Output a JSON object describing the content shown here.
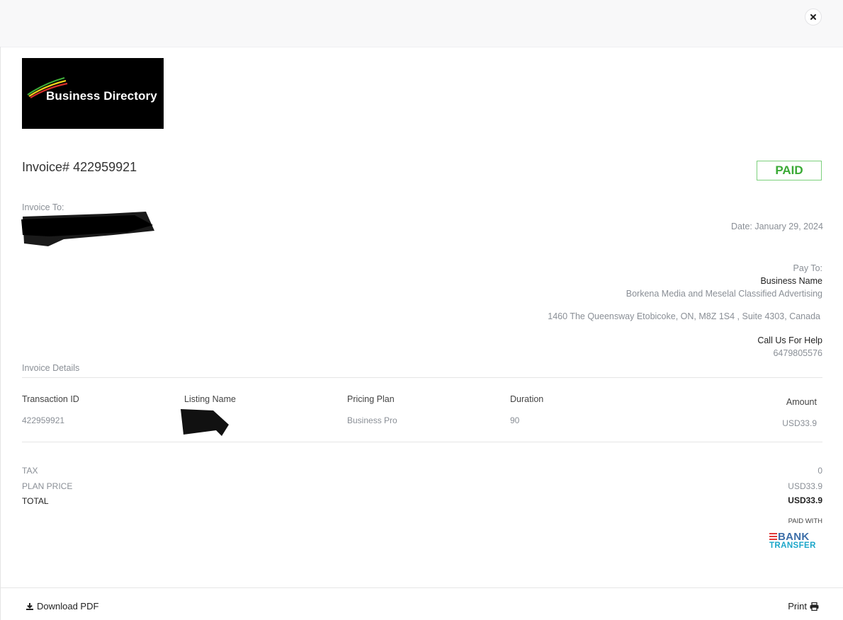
{
  "logo": {
    "text": "Business Directory"
  },
  "invoice": {
    "label": "Invoice#",
    "number": "422959921",
    "status": "PAID"
  },
  "invoice_to": {
    "label": "Invoice To:"
  },
  "date": {
    "text": "Date: January 29, 2024"
  },
  "pay_to": {
    "label": "Pay To:",
    "business_label": "Business Name",
    "business_name": "Borkena Media and Meselal Classified Advertising",
    "address": "1460 The Queensway Etobicoke, ON, M8Z 1S4 , Suite 4303, Canada",
    "help_label": "Call Us For Help",
    "phone": "6479805576"
  },
  "details": {
    "title": "Invoice Details",
    "headers": {
      "transaction_id": "Transaction ID",
      "listing_name": "Listing Name",
      "pricing_plan": "Pricing Plan",
      "duration": "Duration",
      "amount": "Amount"
    },
    "row": {
      "transaction_id": "422959921",
      "pricing_plan": "Business Pro",
      "duration": "90",
      "amount": "USD33.9"
    }
  },
  "summary": {
    "tax_label": "TAX",
    "tax_value": "0",
    "plan_price_label": "PLAN PRICE",
    "plan_price_value": "USD33.9",
    "total_label": "TOTAL",
    "total_value": "USD33.9"
  },
  "payment": {
    "paid_with_label": "PAID WITH",
    "method_line1": "BANK",
    "method_line2": "TRANSFER"
  },
  "footer": {
    "download_label": "Download PDF",
    "print_label": "Print"
  },
  "colors": {
    "paid_green": "#3aaa35",
    "bank_blue": "#3c6ea8",
    "transfer_cyan": "#1ba6c9",
    "bank_red": "#e23b3b"
  }
}
